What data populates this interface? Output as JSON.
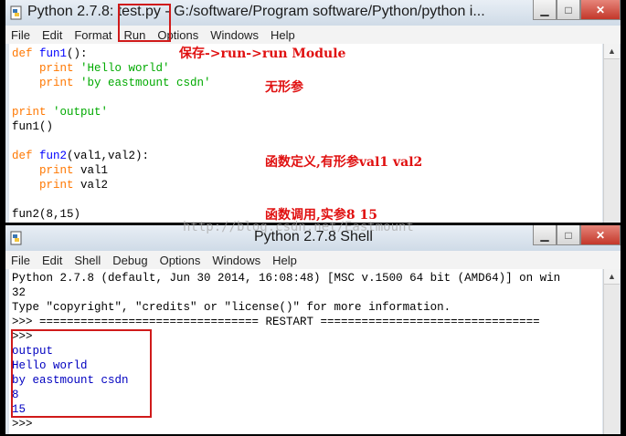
{
  "editor": {
    "title_prefix": "Python 2.7.8: ",
    "filename": "test.py",
    "title_suffix": " - G:/software/Program software/Python/python i...",
    "menu": [
      "File",
      "Edit",
      "Format",
      "Run",
      "Options",
      "Windows",
      "Help"
    ],
    "code": {
      "l1_kw": "def ",
      "l1_fn": "fun1",
      "l1_rest": "():",
      "l2_kw": "    print ",
      "l2_str": "'Hello world'",
      "l3_kw": "    print ",
      "l3_str": "'by eastmount csdn'",
      "l4_kw": "print ",
      "l4_str": "'output'",
      "l5": "fun1()",
      "l6_kw": "def ",
      "l6_fn": "fun2",
      "l6_rest": "(val1,val2):",
      "l7_kw": "    print ",
      "l7_rest": "val1",
      "l8_kw": "    print ",
      "l8_rest": "val2",
      "l9": "fun2(8,15)"
    },
    "annotations": {
      "save_run": "保存->run->run Module",
      "no_params": "无形参",
      "func_def": "函数定义,有形参val1 val2",
      "func_call": "函数调用,实参8 15"
    }
  },
  "shell": {
    "title": "Python 2.7.8 Shell",
    "menu": [
      "File",
      "Edit",
      "Shell",
      "Debug",
      "Options",
      "Windows",
      "Help"
    ],
    "lines": {
      "banner1": "Python 2.7.8 (default, Jun 30 2014, 16:08:48) [MSC v.1500 64 bit (AMD64)] on win",
      "banner2": "32",
      "banner3": "Type \"copyright\", \"credits\" or \"license()\" for more information.",
      "restart": ">>> ================================ RESTART ================================",
      "prompt1": ">>>",
      "out1": "output",
      "out2": "Hello world",
      "out3": "by eastmount csdn",
      "out4": "8",
      "out5": "15",
      "prompt2": ">>>"
    }
  },
  "watermark": "http://blog.csdn.net/Eastmount",
  "colors": {
    "keyword": "#ff7700",
    "defname": "#0000ff",
    "string": "#00aa00",
    "output": "#0000c0",
    "annotation": "#e01010"
  }
}
